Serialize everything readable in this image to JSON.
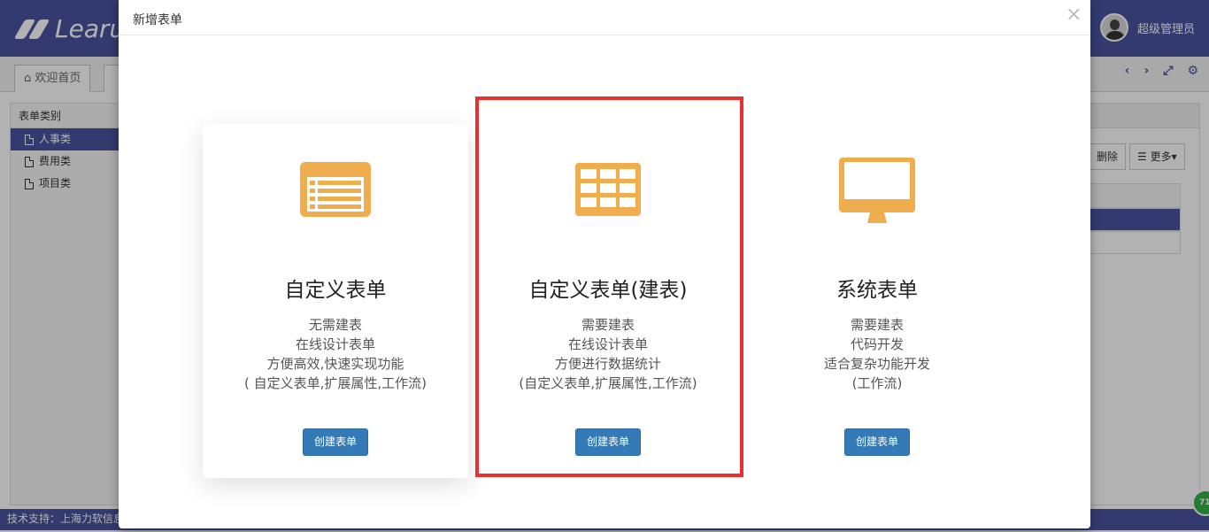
{
  "app": {
    "logo_text": "Learu",
    "user_name": "超级管理员",
    "footer_text": "技术支持：上海力软信息",
    "badge_text": "71"
  },
  "tabs": [
    {
      "label": "⌂ 欢迎首页"
    },
    {
      "label": ""
    }
  ],
  "sidebar": {
    "title": "表单类别",
    "items": [
      {
        "label": "人事类"
      },
      {
        "label": "费用类"
      },
      {
        "label": "项目类"
      }
    ]
  },
  "toolbar": {
    "delete_label": "删除",
    "more_label": "☰ 更多▾"
  },
  "modal": {
    "title": "新增表单",
    "close_glyph": "×",
    "cards": [
      {
        "icon": "list-form-icon",
        "title": "自定义表单",
        "lines": [
          "无需建表",
          "在线设计表单",
          "方便高效,快速实现功能",
          "( 自定义表单,扩展属性,工作流)"
        ],
        "button": "创建表单"
      },
      {
        "icon": "table-grid-icon",
        "title": "自定义表单(建表)",
        "lines": [
          "需要建表",
          "在线设计表单",
          "方便进行数据统计",
          "(自定义表单,扩展属性,工作流)"
        ],
        "button": "创建表单"
      },
      {
        "icon": "monitor-icon",
        "title": "系统表单",
        "lines": [
          "需要建表",
          "代码开发",
          "适合复杂功能开发",
          "(工作流)"
        ],
        "button": "创建表单"
      }
    ]
  },
  "colors": {
    "brand": "#4a549f",
    "icon": "#f0ad4e",
    "button": "#337ab7",
    "highlight": "#ea2f2f"
  }
}
